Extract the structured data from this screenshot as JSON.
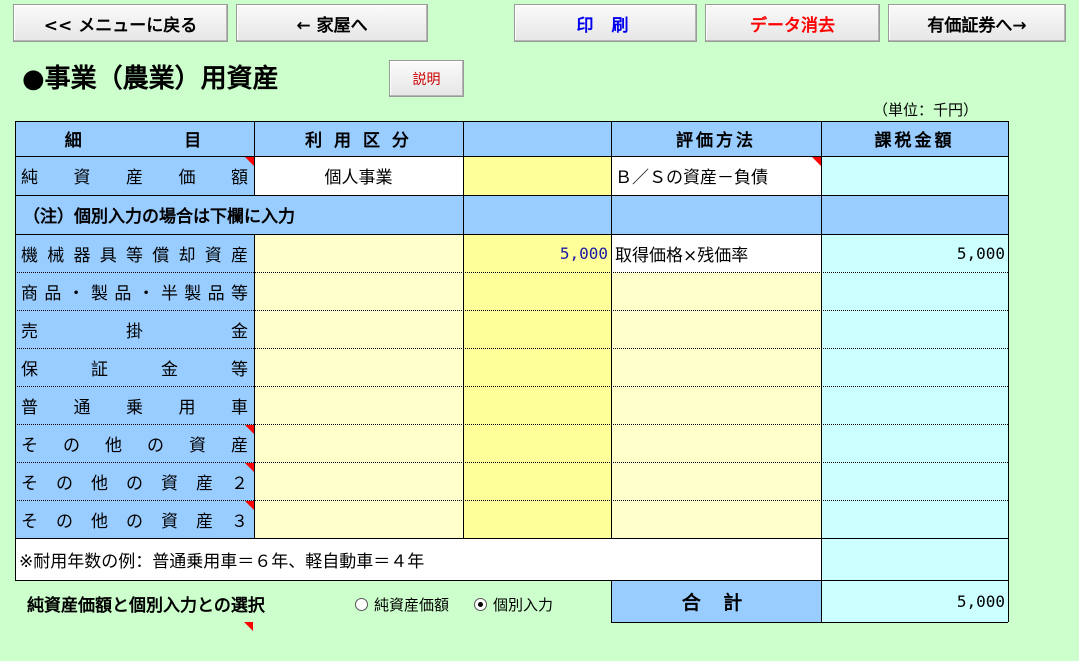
{
  "toolbar": {
    "menu_label": "<< メニューに戻る",
    "house_label": "← 家屋へ",
    "print_label": "印 刷",
    "clear_label": "データ消去",
    "securities_label": "有価証券へ→"
  },
  "page": {
    "title": "●事業（農業）用資産",
    "help_label": "説明",
    "unit": "（単位：千円）"
  },
  "table": {
    "headers": {
      "item_left": "細",
      "item_right": "目",
      "usage": "利 用 区 分",
      "method": "評価方法",
      "tax": "課税金額"
    },
    "net_row": {
      "label_chars": [
        "純",
        "資",
        "産",
        "価",
        "額"
      ],
      "usage": "個人事業",
      "method": "Ｂ／Ｓの資産－負債"
    },
    "note_row": "（注）個別入力の場合は下欄に入力",
    "rows": [
      {
        "label_chars": [
          "機",
          "械",
          "器",
          "具",
          "等",
          "償",
          "却",
          "資",
          "産"
        ],
        "value": "5,000",
        "method": "取得価格×残価率",
        "tax": "5,000"
      },
      {
        "label_chars": [
          "商",
          "品",
          "・",
          "製",
          "品",
          "・",
          "半",
          "製",
          "品",
          "等"
        ],
        "value": "",
        "method": "",
        "tax": ""
      },
      {
        "label_chars": [
          "売",
          "掛",
          "金"
        ],
        "value": "",
        "method": "",
        "tax": ""
      },
      {
        "label_chars": [
          "保",
          "証",
          "金",
          "等"
        ],
        "value": "",
        "method": "",
        "tax": ""
      },
      {
        "label_chars": [
          "普",
          "通",
          "乗",
          "用",
          "車"
        ],
        "value": "",
        "method": "",
        "tax": ""
      },
      {
        "label_chars": [
          "そ",
          "の",
          "他",
          "の",
          "資",
          "産"
        ],
        "value": "",
        "method": "",
        "tax": ""
      },
      {
        "label_chars": [
          "そ",
          "の",
          "他",
          "の",
          "資",
          "産",
          "２"
        ],
        "value": "",
        "method": "",
        "tax": ""
      },
      {
        "label_chars": [
          "そ",
          "の",
          "他",
          "の",
          "資",
          "産",
          "３"
        ],
        "value": "",
        "method": "",
        "tax": ""
      }
    ],
    "footnote": "※耐用年数の例：普通乗用車＝６年、軽自動車＝４年",
    "total_label": "合 計",
    "total_value": "5,000"
  },
  "selection": {
    "label": "純資産価額と個別入力との選択",
    "option_net": "純資産価額",
    "option_individual": "個別入力",
    "selected": "個別入力"
  }
}
